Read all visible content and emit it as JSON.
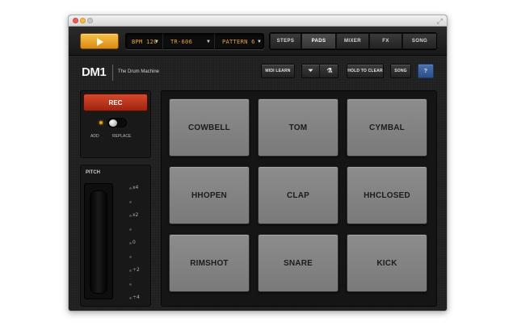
{
  "topbar": {
    "play_label": "",
    "bpm": "BPM 120",
    "kit": "TR-606",
    "pattern": "PATTERN 6",
    "tabs": [
      {
        "label": "STEPS"
      },
      {
        "label": "PADS"
      },
      {
        "label": "MIXER"
      },
      {
        "label": "FX"
      },
      {
        "label": "SONG"
      }
    ],
    "active_tab": "PADS"
  },
  "brand": {
    "logo": "DM1",
    "tagline": "The Drum Machine"
  },
  "toolbar": {
    "midi_learn": "MIDI LEARN",
    "hold_to_clear": "HOLD TO CLEAR",
    "song": "SONG",
    "help": "?"
  },
  "record": {
    "rec_label": "REC",
    "add_label": "ADD",
    "replace_label": "REPLACE"
  },
  "pitch": {
    "label": "PITCH",
    "ticks": [
      "x4",
      "x2",
      "0",
      "÷2",
      "÷4"
    ]
  },
  "pads": [
    {
      "label": "COWBELL"
    },
    {
      "label": "TOM"
    },
    {
      "label": "CYMBAL"
    },
    {
      "label": "HHOPEN"
    },
    {
      "label": "CLAP"
    },
    {
      "label": "HHCLOSED"
    },
    {
      "label": "RIMSHOT"
    },
    {
      "label": "SNARE"
    },
    {
      "label": "KICK"
    }
  ],
  "colors": {
    "accent": "#f0b23a",
    "rec": "#c8381f",
    "pad": "#858585",
    "help": "#3d5e9c"
  }
}
